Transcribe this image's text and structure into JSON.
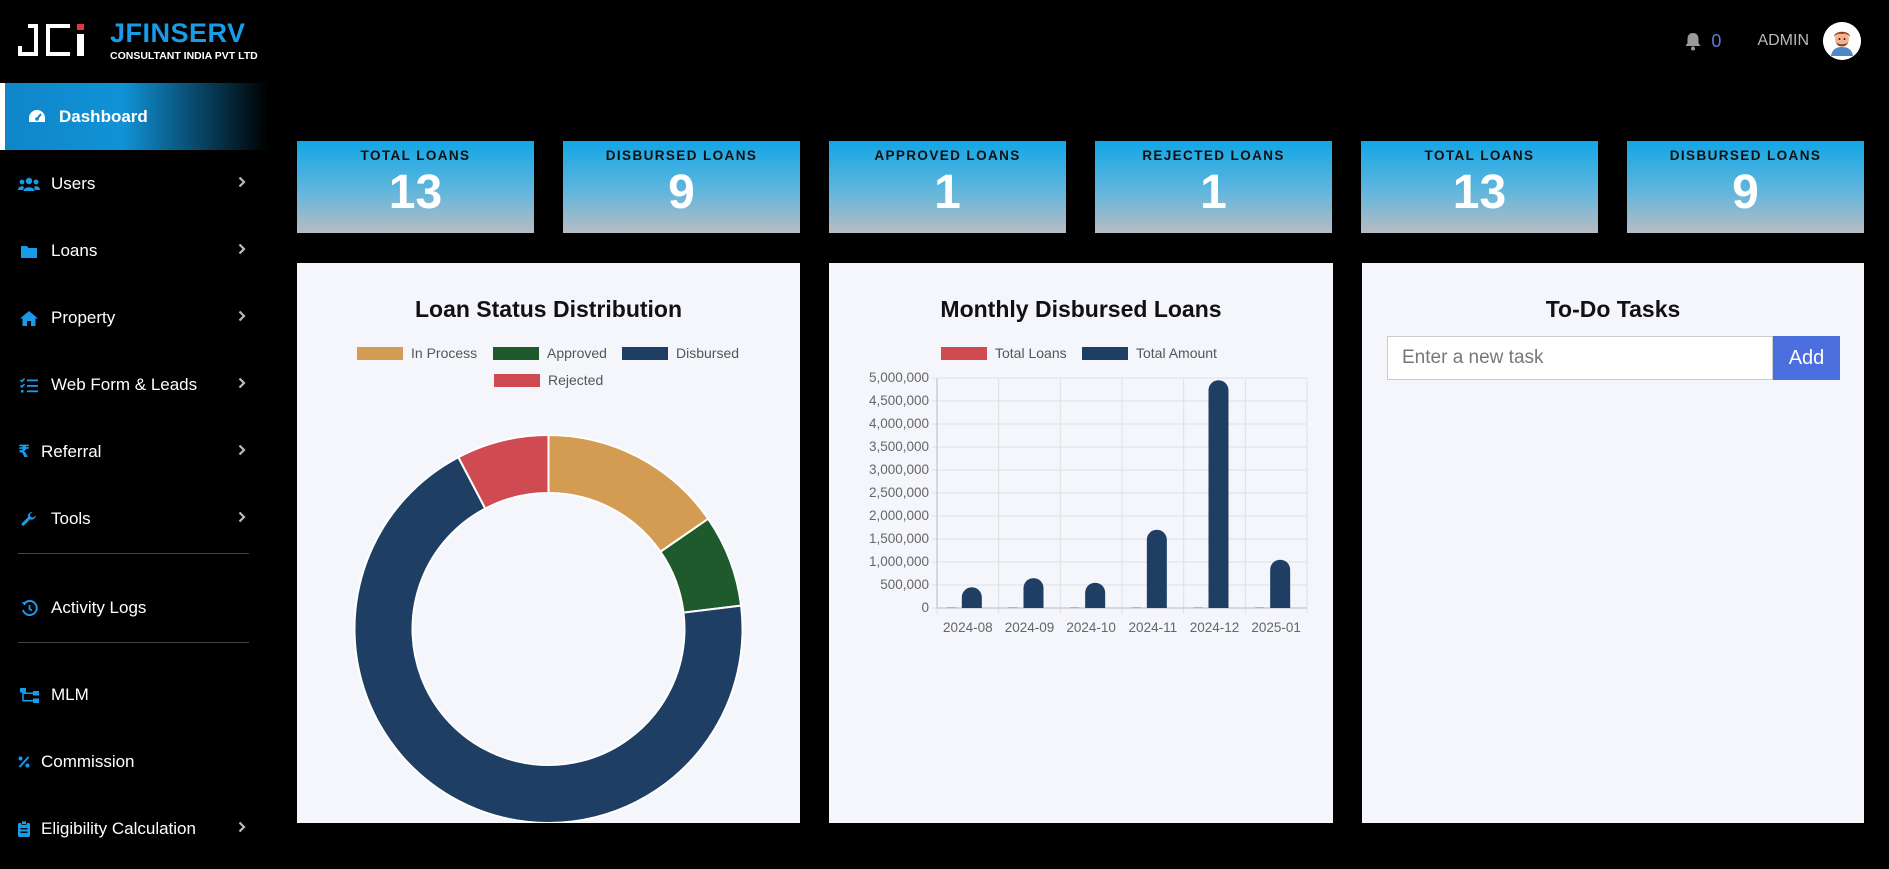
{
  "brand": {
    "name": "JFINSERV",
    "subtitle": "CONSULTANT INDIA PVT LTD"
  },
  "header": {
    "notification_count": "0",
    "user_label": "ADMIN"
  },
  "sidebar": {
    "items": [
      {
        "label": "Dashboard",
        "icon": "dashboard-icon",
        "active": true
      },
      {
        "label": "Users",
        "icon": "users-icon",
        "has_submenu": true
      },
      {
        "label": "Loans",
        "icon": "folder-icon",
        "has_submenu": true
      },
      {
        "label": "Property",
        "icon": "home-icon",
        "has_submenu": true
      },
      {
        "label": "Web Form & Leads",
        "icon": "list-check-icon",
        "has_submenu": true
      },
      {
        "label": "Referral",
        "icon": "rupee-icon",
        "has_submenu": true
      },
      {
        "label": "Tools",
        "icon": "wrench-icon",
        "has_submenu": true
      },
      {
        "label": "Activity Logs",
        "icon": "history-icon"
      },
      {
        "label": "MLM",
        "icon": "sitemap-icon"
      },
      {
        "label": "Commission",
        "icon": "percent-icon"
      },
      {
        "label": "Eligibility Calculation",
        "icon": "clipboard-icon",
        "has_submenu": true
      }
    ]
  },
  "stats": [
    {
      "title": "TOTAL LOANS",
      "value": "13"
    },
    {
      "title": "DISBURSED LOANS",
      "value": "9"
    },
    {
      "title": "APPROVED LOANS",
      "value": "1"
    },
    {
      "title": "REJECTED LOANS",
      "value": "1"
    },
    {
      "title": "TOTAL LOANS",
      "value": "13"
    },
    {
      "title": "DISBURSED LOANS",
      "value": "9"
    }
  ],
  "colors": {
    "accent": "#1a9be8",
    "in_process": "#d49c52",
    "approved": "#1f5a2c",
    "disbursed": "#1f3e63",
    "rejected": "#cf4b51",
    "add_button": "#4c6fe0"
  },
  "chart_data": [
    {
      "type": "pie",
      "title": "Loan Status Distribution",
      "donut": true,
      "categories": [
        "In Process",
        "Approved",
        "Disbursed",
        "Rejected"
      ],
      "values": [
        2,
        1,
        9,
        1
      ],
      "colors": [
        "#d49c52",
        "#1f5a2c",
        "#1f3e63",
        "#cf4b51"
      ],
      "legend": "top"
    },
    {
      "type": "bar",
      "title": "Monthly Disbursed Loans",
      "categories": [
        "2024-08",
        "2024-09",
        "2024-10",
        "2024-11",
        "2024-12",
        "2025-01"
      ],
      "series": [
        {
          "name": "Total Loans",
          "color": "#cf4b51",
          "values": [
            1,
            1,
            1,
            2,
            3,
            1
          ]
        },
        {
          "name": "Total Amount",
          "color": "#1f3e63",
          "values": [
            450000,
            650000,
            550000,
            1700000,
            4950000,
            1050000
          ]
        }
      ],
      "ylim": [
        0,
        5000000
      ],
      "yticks": [
        "5,000,000",
        "4,500,000",
        "4,000,000",
        "3,500,000",
        "3,000,000",
        "2,500,000",
        "2,000,000",
        "1,500,000",
        "1,000,000",
        "500,000",
        "0"
      ],
      "grid": true,
      "legend": "top"
    }
  ],
  "todo": {
    "title": "To-Do Tasks",
    "placeholder": "Enter a new task",
    "add_label": "Add"
  }
}
